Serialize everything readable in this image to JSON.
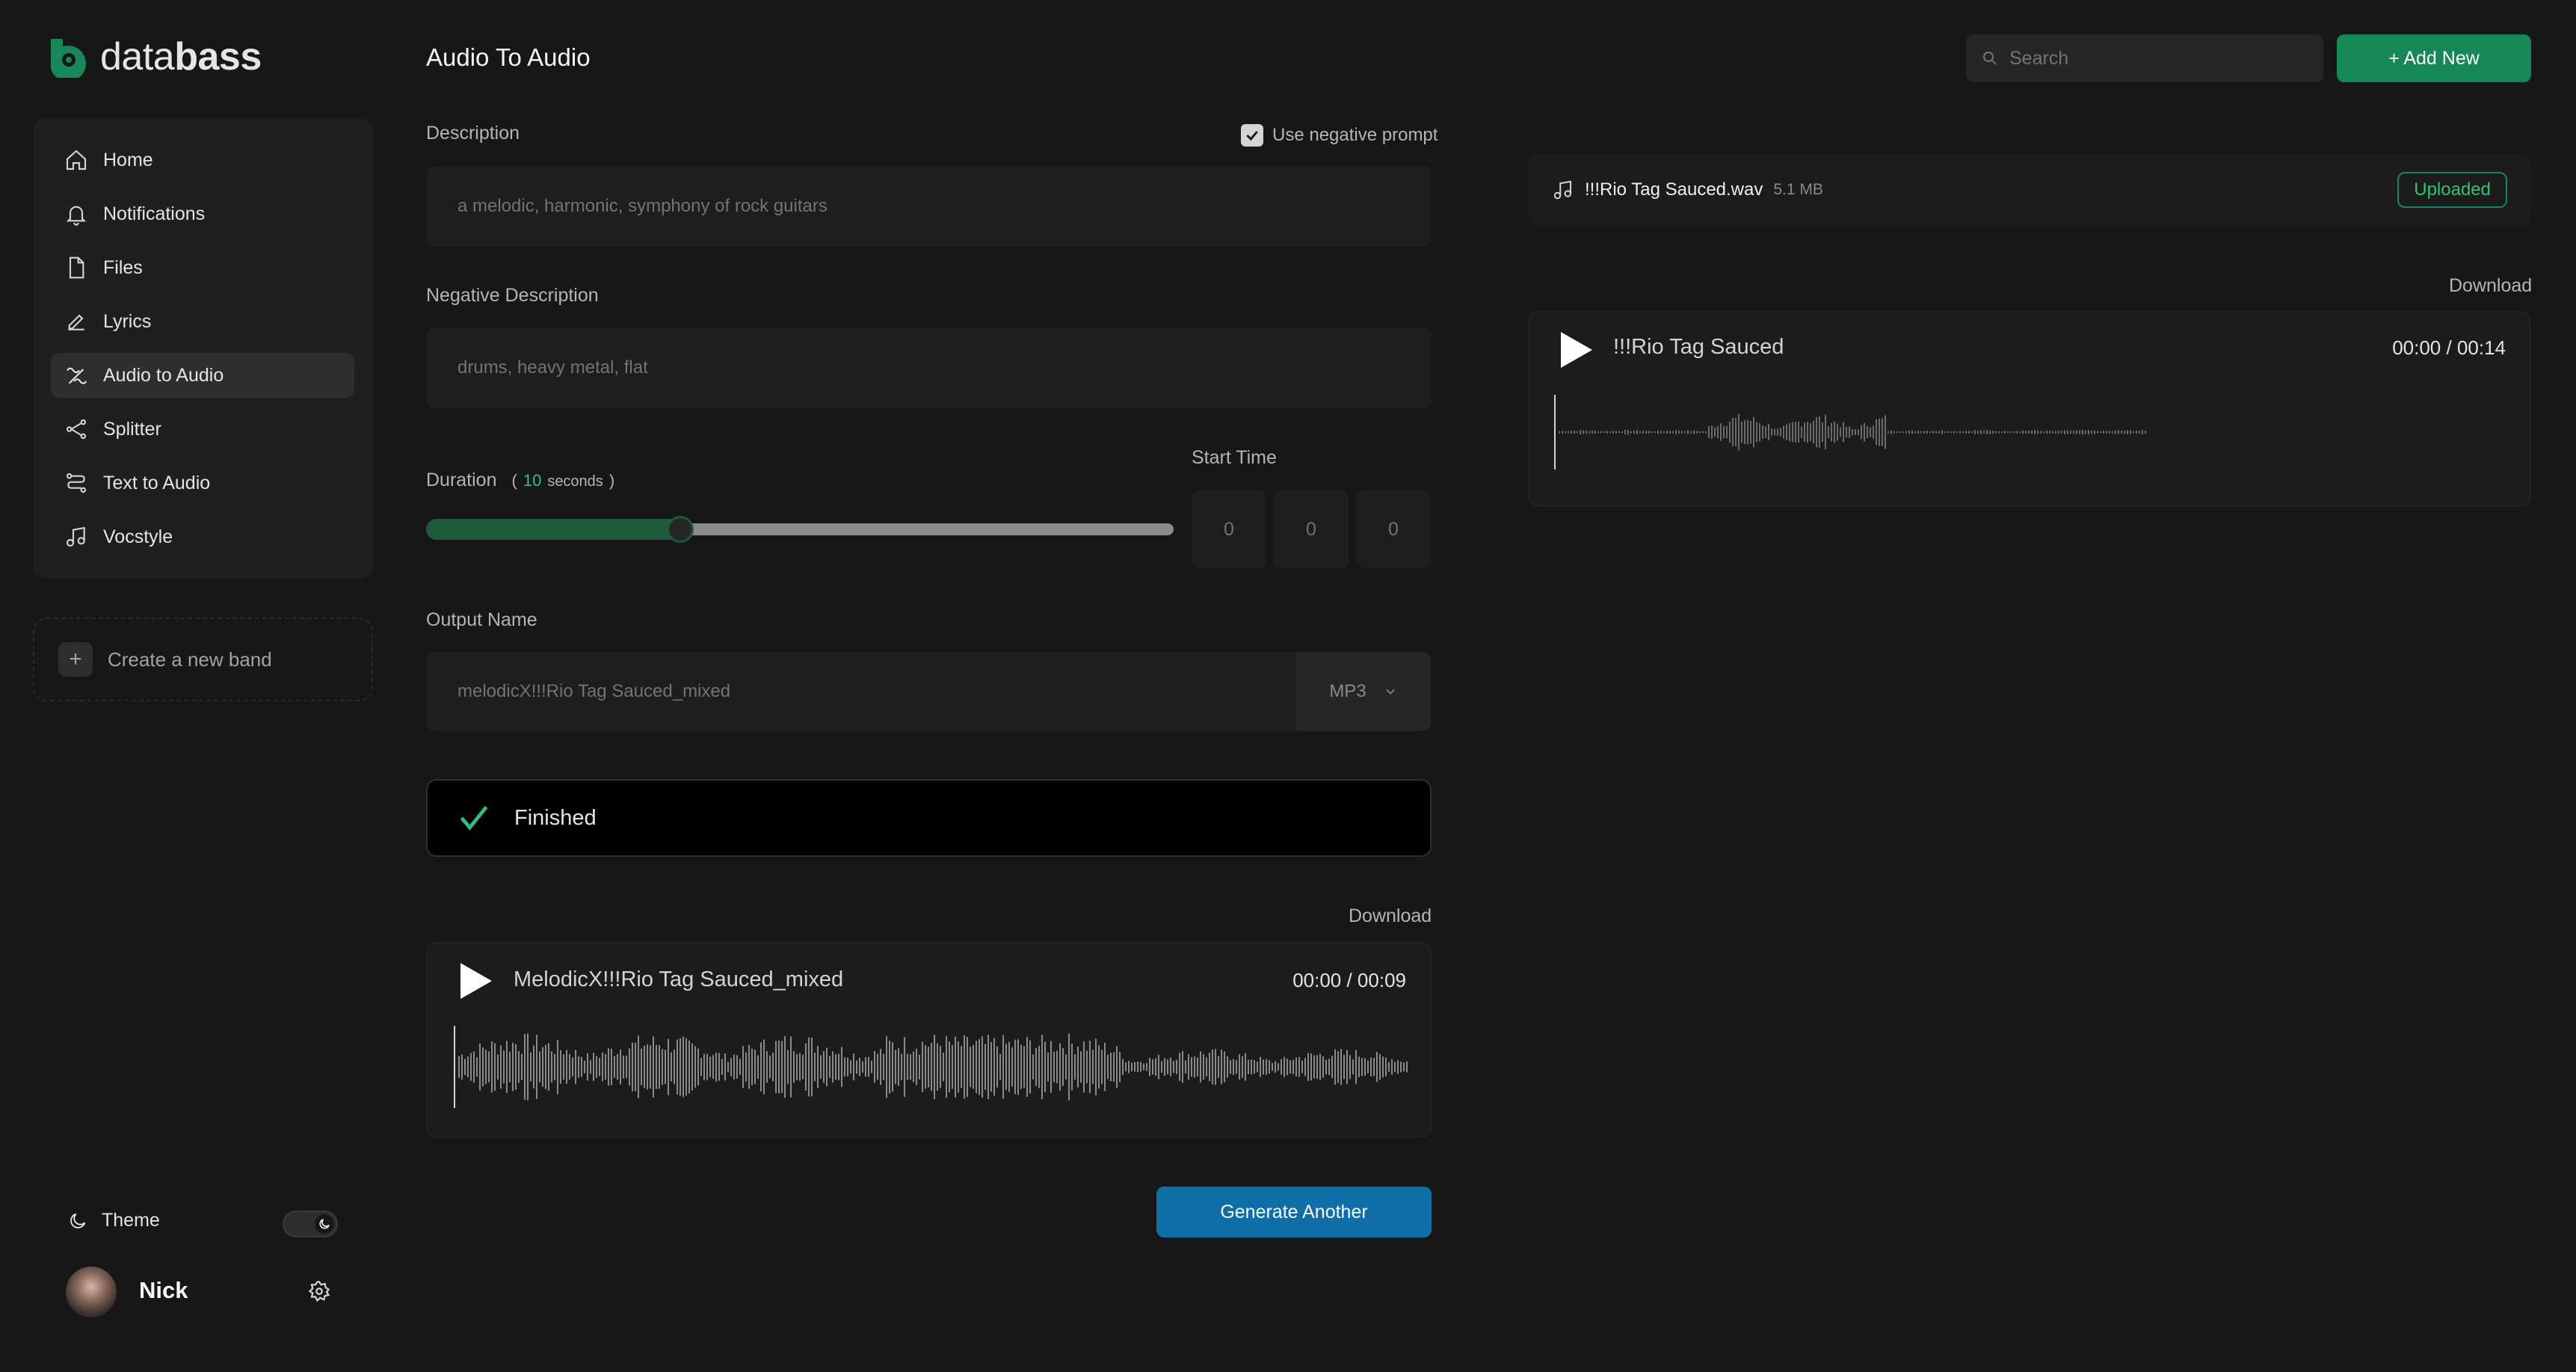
{
  "brand": {
    "name_light": "data",
    "name_bold": "bass",
    "accent": "#168757"
  },
  "sidebar": {
    "items": [
      {
        "label": "Home",
        "icon": "home-icon"
      },
      {
        "label": "Notifications",
        "icon": "bell-icon"
      },
      {
        "label": "Files",
        "icon": "file-icon"
      },
      {
        "label": "Lyrics",
        "icon": "pencil-icon"
      },
      {
        "label": "Audio to Audio",
        "icon": "audio-to-audio-icon",
        "active": true
      },
      {
        "label": "Splitter",
        "icon": "splitter-icon"
      },
      {
        "label": "Text to Audio",
        "icon": "text-to-audio-icon"
      },
      {
        "label": "Vocstyle",
        "icon": "music-note-icon"
      }
    ],
    "create_band": "Create a new band",
    "theme_label": "Theme",
    "user_name": "Nick"
  },
  "header": {
    "title": "Audio To Audio",
    "search_placeholder": "Search",
    "add_new": "+ Add New"
  },
  "form": {
    "description_label": "Description",
    "use_negative_prompt": "Use negative prompt",
    "use_negative_checked": true,
    "description_value": "a melodic, harmonic, symphony of rock guitars",
    "negative_label": "Negative Description",
    "negative_value": "drums, heavy metal, flat",
    "duration_label": "Duration",
    "duration_paren_open": "(",
    "duration_value": "10",
    "duration_unit": "seconds",
    "duration_paren_close": ")",
    "duration_fraction": 0.33,
    "start_time_label": "Start Time",
    "start_time": [
      "0",
      "0",
      "0"
    ],
    "output_label": "Output Name",
    "output_value": "melodicX!!!Rio Tag Sauced_mixed",
    "format": "MP3"
  },
  "status": {
    "text": "Finished"
  },
  "result": {
    "download": "Download",
    "title": "MelodicX!!!Rio Tag Sauced_mixed",
    "time": "00:00 / 00:09"
  },
  "generate_button": "Generate Another",
  "upload": {
    "file_name": "!!!Rio Tag Sauced.wav",
    "file_size": "5.1 MB",
    "status": "Uploaded",
    "download": "Download",
    "title": "!!!Rio Tag Sauced",
    "time": "00:00 / 00:14"
  }
}
